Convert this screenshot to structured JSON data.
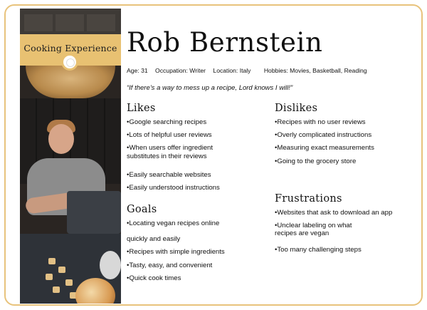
{
  "persona": {
    "banner": "Cooking Experience",
    "name": "Rob Bernstein",
    "meta": {
      "age": "Age: 31",
      "occupation": "Occupation: Writer",
      "location": "Location: Italy",
      "hobbies": "Hobbies: Movies, Basketball, Reading"
    },
    "quote": "“If there’s a way to mess up a recipe, Lord knows I will!”"
  },
  "likes": {
    "title": "Likes",
    "items": [
      "•Google searching recipes",
      "•Lots of helpful user reviews",
      "•When users offer ingredient",
      "substitutes in their reviews",
      "•Easily searchable websites",
      "•Easily understood instructions"
    ]
  },
  "dislikes": {
    "title": "Dislikes",
    "items": [
      "•Recipes with no user reviews",
      "•Overly complicated instructions",
      "•Measuring exact measurements",
      "•Going to the grocery store"
    ]
  },
  "goals": {
    "title": "Goals",
    "items": [
      "•Locating vegan recipes online",
      "quickly and easily",
      "•Recipes with simple ingredients",
      "•Tasty, easy, and convenient",
      "•Quick cook times"
    ]
  },
  "frustrations": {
    "title": "Frustrations",
    "items": [
      "•Websites that ask to download an app",
      "•Unclear labeling on what",
      "recipes are vegan",
      "•Too many challenging steps"
    ]
  },
  "colors": {
    "accent": "#e8c172",
    "border": "#e8c37c",
    "text": "#111111"
  }
}
